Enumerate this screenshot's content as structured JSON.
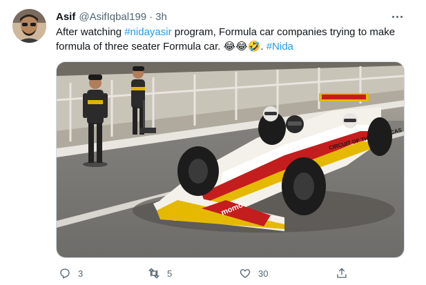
{
  "author": {
    "name": "Asif",
    "handle": "@AsifIqbal199",
    "separator": "·",
    "time": "3h"
  },
  "tweet": {
    "text_1": "After watching ",
    "hashtag_1": "#nidayasir",
    "text_2": " program, Formula car companies trying to make formula of three seater Formula car. ",
    "emojis": "😂😂🤣",
    "text_3": ". ",
    "hashtag_2": "#Nida"
  },
  "media": {
    "nose_brand": "momo",
    "sidepod_brand": "CIRCUIT OF THE AMERICAS",
    "colors": {
      "car_white": "#f4f1ea",
      "car_red": "#c41d1d",
      "car_gold": "#e5b900",
      "asphalt": "#8e8c88"
    }
  },
  "actions": {
    "reply_count": "3",
    "retweet_count": "5",
    "like_count": "30"
  },
  "icons": [
    "more-icon",
    "reply-icon",
    "retweet-icon",
    "like-icon",
    "share-icon"
  ]
}
